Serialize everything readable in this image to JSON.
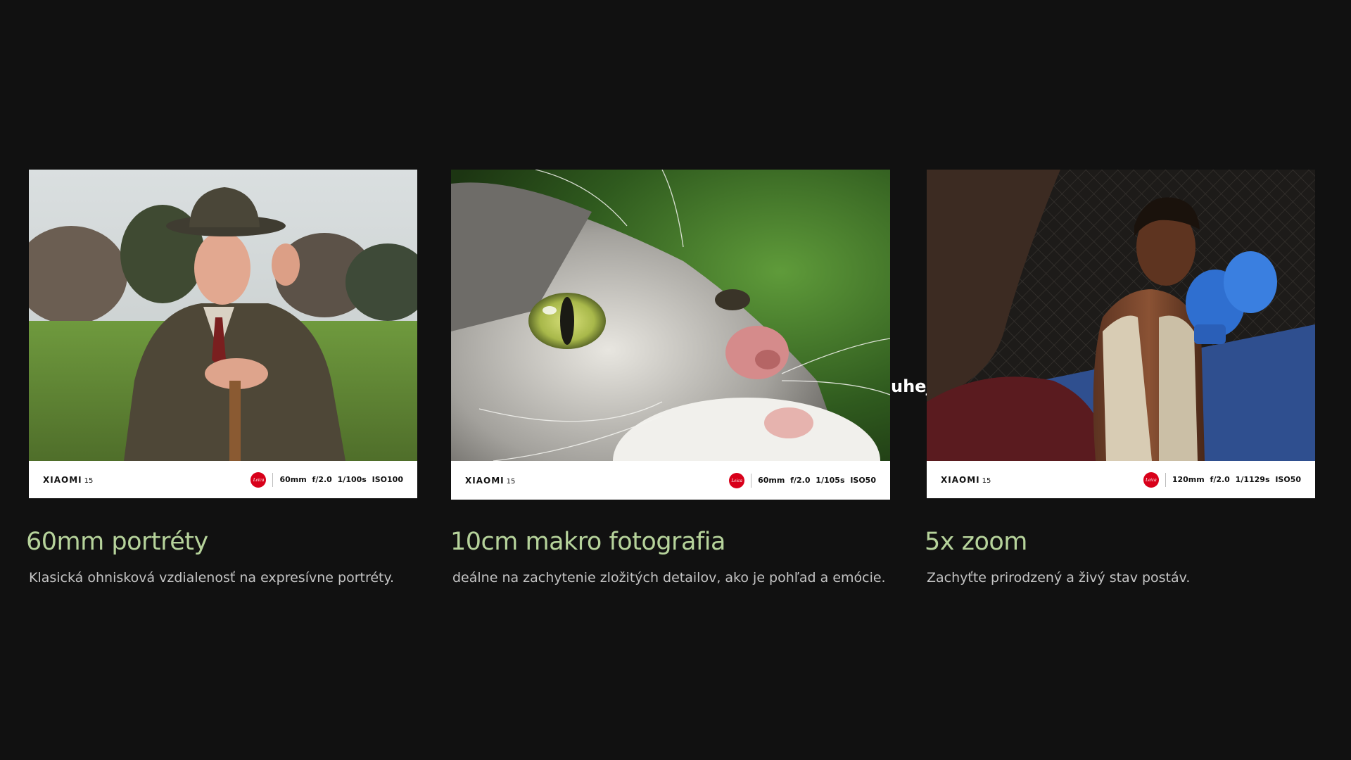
{
  "cards": [
    {
      "brand": "XIAOMI",
      "model": "15",
      "leica_badge": "Leica",
      "settings": "60mm  f/2.0  1/100s  ISO100",
      "heading": "60mm portréty",
      "description": "Klasická ohnisková vzdialenosť na expresívne portréty."
    },
    {
      "brand": "XIAOMI",
      "model": "15",
      "leica_badge": "Leica",
      "settings": "60mm  f/2.0  1/105s  ISO50",
      "heading": "10cm makro fotografia",
      "description": "deálne na zachytenie zložitých detailov, ako je pohľad a emócie."
    },
    {
      "brand": "XIAOMI",
      "model": "15",
      "leica_badge": "Leica",
      "settings": "120mm  f/2.0  1/1129s  ISO50",
      "heading": "5x zoom",
      "description": "Zachyťte prirodzený a živý stav postáv."
    }
  ],
  "peek_text": "uhej",
  "colors": {
    "background": "#111111",
    "heading": "#b6d39b",
    "description": "#c4c4c4",
    "leica_red": "#d8001a"
  }
}
